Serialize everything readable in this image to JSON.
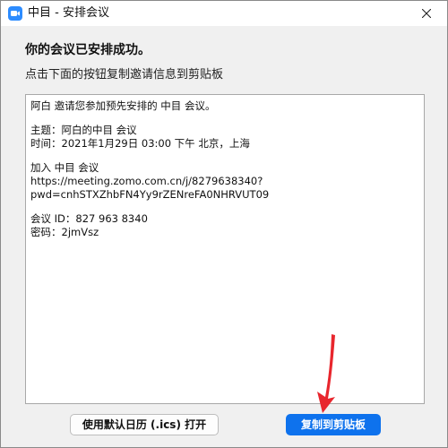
{
  "window": {
    "title": "中目 - 安排会议",
    "app_icon": "camera-app-icon",
    "close_icon": "close-icon"
  },
  "dialog": {
    "headline": "你的会议已安排成功。",
    "instruction": "点击下面的按钮复制邀请信息到剪贴板"
  },
  "invitation": {
    "lines": [
      "阿白 邀请您参加预先安排的 中目 会议。",
      "",
      "主题：阿白的中目 会议",
      "时间：2021年1月29日 03:00 下午 北京，上海",
      "",
      "加入 中目 会议",
      "https://meeting.zomo.com.cn/j/8279638340?",
      "pwd=cnhSTXZhbFN4Yy9rZENreFA0NHRVUT09",
      "",
      "会议 ID：827 963 8340",
      "密码：2jmVsz"
    ]
  },
  "buttons": {
    "calendar_label": "使用默认日历 (.ics) 打开",
    "copy_label": "复制到剪贴板"
  },
  "colors": {
    "accent": "#0e72ed",
    "annotation_arrow": "#e8262d"
  }
}
